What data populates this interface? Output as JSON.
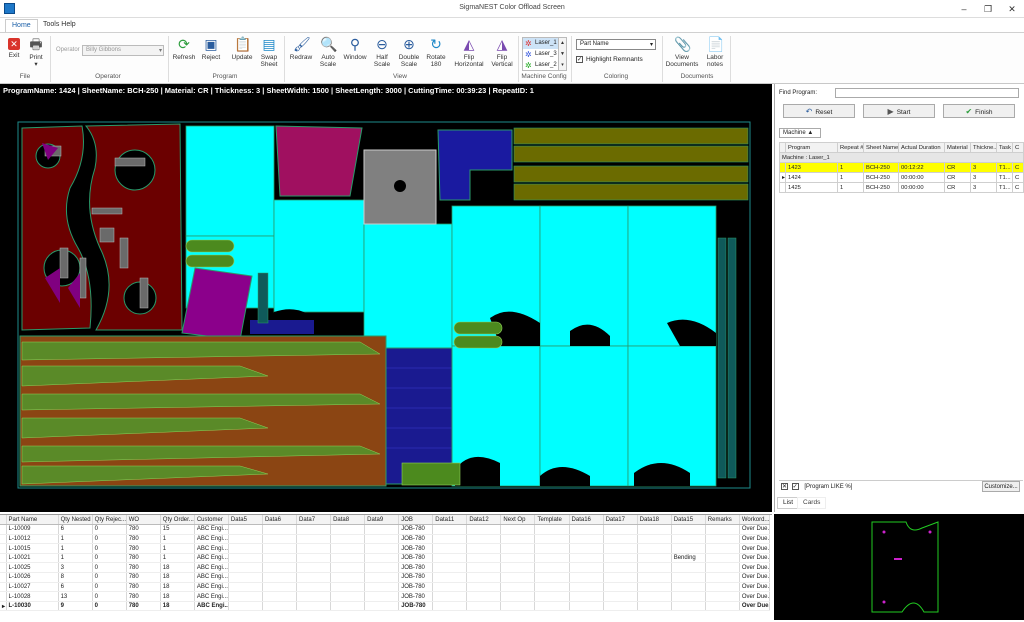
{
  "window": {
    "title": "SigmaNEST Color Offload Screen"
  },
  "tabs": [
    {
      "label": "Home"
    },
    {
      "label": "Tools Help"
    }
  ],
  "ribbon": {
    "file": {
      "exit": "Exit",
      "print": "Print",
      "group": "File"
    },
    "operator": {
      "label": "Operator",
      "value": "Billy Gibbons",
      "group": "Operator"
    },
    "program": {
      "refresh": "Refresh",
      "reject": "Reject",
      "update": "Update",
      "swap1": "Swap",
      "swap2": "Sheet",
      "group": "Program"
    },
    "view": {
      "redraw": "Redraw",
      "auto1": "Auto",
      "auto2": "Scale",
      "window": "Window",
      "half1": "Half",
      "half2": "Scale",
      "double1": "Double",
      "double2": "Scale",
      "rotate1": "Rotate",
      "rotate2": "180",
      "fliph1": "Flip",
      "fliph2": "Horizontal",
      "flipv1": "Flip",
      "flipv2": "Vertical",
      "group": "View"
    },
    "machine_config": {
      "items": [
        "Laser_1",
        "Laser_3",
        "Laser_2"
      ],
      "group": "Machine Config"
    },
    "coloring": {
      "selected": "Part Name",
      "highlight": "Highlight Remnants",
      "group": "Coloring"
    },
    "documents": {
      "view1": "View",
      "view2": "Documents",
      "labor1": "Labor",
      "labor2": "notes",
      "group": "Documents"
    }
  },
  "infobar": {
    "text": "ProgramName: 1424 | SheetName: BCH-250 | Material: CR | Thickness: 3 | SheetWidth: 1500 | SheetLength: 3000 | CuttingTime: 00:39:23 | RepeatID: 1"
  },
  "right_panel": {
    "find_label": "Find Program:",
    "reset": "Reset",
    "start": "Start",
    "finish": "Finish",
    "machine_filter": "Machine",
    "columns": [
      "Program",
      "Repeat #",
      "Sheet Name",
      "Actual Duration",
      "Material",
      "Thickne...",
      "Task",
      "C"
    ],
    "group_row": "Machine : Laser_1",
    "rows": [
      [
        "1423",
        "1",
        "BCH-250",
        "00:12:22",
        "CR",
        "3",
        "T1...",
        "C"
      ],
      [
        "1424",
        "1",
        "BCH-250",
        "00:00:00",
        "CR",
        "3",
        "T1...",
        "C"
      ],
      [
        "1425",
        "1",
        "BCH-250",
        "00:00:00",
        "CR",
        "3",
        "T1...",
        "C"
      ]
    ],
    "filter_text": "[Program LIKE %]",
    "customize": "Customize...",
    "list_tab": "List",
    "cards_tab": "Cards"
  },
  "parts_grid": {
    "columns": [
      "Part Name",
      "Qty Nested",
      "Qty Rejec...",
      "WO",
      "Qty Order...",
      "Customer",
      "Data5",
      "Data6",
      "Data7",
      "Data8",
      "Data9",
      "JOB",
      "Data11",
      "Data12",
      "Next Op",
      "Template",
      "Data16",
      "Data17",
      "Data18",
      "Data15",
      "Remarks",
      "Workord..."
    ],
    "rows": [
      [
        "L-10009",
        "6",
        "0",
        "780",
        "15",
        "ABC Engi...",
        "",
        "",
        "",
        "",
        "",
        "JOB-780",
        "",
        "",
        "",
        "",
        "",
        "",
        "",
        "",
        "",
        "Over Due..."
      ],
      [
        "L-10012",
        "1",
        "0",
        "780",
        "1",
        "ABC Engi...",
        "",
        "",
        "",
        "",
        "",
        "JOB-780",
        "",
        "",
        "",
        "",
        "",
        "",
        "",
        "",
        "",
        "Over Due..."
      ],
      [
        "L-10015",
        "1",
        "0",
        "780",
        "1",
        "ABC Engi...",
        "",
        "",
        "",
        "",
        "",
        "JOB-780",
        "",
        "",
        "",
        "",
        "",
        "",
        "",
        "",
        "",
        "Over Due..."
      ],
      [
        "L-10021",
        "1",
        "0",
        "780",
        "1",
        "ABC Engi...",
        "",
        "",
        "",
        "",
        "",
        "JOB-780",
        "",
        "",
        "",
        "",
        "",
        "",
        "",
        "Bending",
        "",
        "Over Due..."
      ],
      [
        "L-10025",
        "3",
        "0",
        "780",
        "18",
        "ABC Engi...",
        "",
        "",
        "",
        "",
        "",
        "JOB-780",
        "",
        "",
        "",
        "",
        "",
        "",
        "",
        "",
        "",
        "Over Due..."
      ],
      [
        "L-10026",
        "8",
        "0",
        "780",
        "18",
        "ABC Engi...",
        "",
        "",
        "",
        "",
        "",
        "JOB-780",
        "",
        "",
        "",
        "",
        "",
        "",
        "",
        "",
        "",
        "Over Due..."
      ],
      [
        "L-10027",
        "6",
        "0",
        "780",
        "18",
        "ABC Engi...",
        "",
        "",
        "",
        "",
        "",
        "JOB-780",
        "",
        "",
        "",
        "",
        "",
        "",
        "",
        "",
        "",
        "Over Due..."
      ],
      [
        "L-10028",
        "13",
        "0",
        "780",
        "18",
        "ABC Engi...",
        "",
        "",
        "",
        "",
        "",
        "JOB-780",
        "",
        "",
        "",
        "",
        "",
        "",
        "",
        "",
        "",
        "Over Due..."
      ],
      [
        "L-10030",
        "9",
        "0",
        "780",
        "18",
        "ABC Engi...",
        "",
        "",
        "",
        "",
        "",
        "JOB-780",
        "",
        "",
        "",
        "",
        "",
        "",
        "",
        "",
        "",
        "Over Due..."
      ]
    ]
  },
  "colors": {
    "cyan": "#00ffff",
    "red_part": "#7a0000",
    "green_part": "#4c8a1e",
    "olive": "#6b6b00",
    "navy": "#1a1aa0",
    "purple": "#800080",
    "highlight": "#ffff00"
  }
}
